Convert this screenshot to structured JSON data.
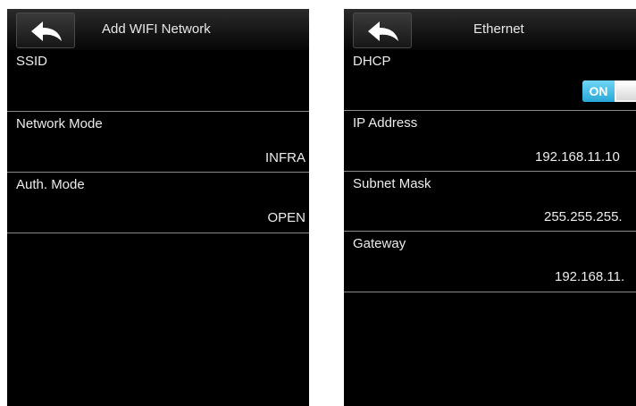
{
  "wifi": {
    "title": "Add WIFI Network",
    "rows": [
      {
        "label": "SSID",
        "value": ""
      },
      {
        "label": "Network Mode",
        "value": "INFRA"
      },
      {
        "label": "Auth. Mode",
        "value": "OPEN"
      }
    ]
  },
  "ethernet": {
    "title": "Ethernet",
    "dhcp": {
      "label": "DHCP",
      "toggle": "ON"
    },
    "rows": [
      {
        "label": "IP Address",
        "value": "192.168.11.10"
      },
      {
        "label": "Subnet Mask",
        "value": "255.255.255."
      },
      {
        "label": "Gateway",
        "value": "192.168.11."
      }
    ]
  },
  "colors": {
    "toggle_on": "#29a7d6",
    "screen_bg": "#000000",
    "divider": "#8a8a8a"
  },
  "icons": {
    "back": "back-arrow-icon"
  }
}
